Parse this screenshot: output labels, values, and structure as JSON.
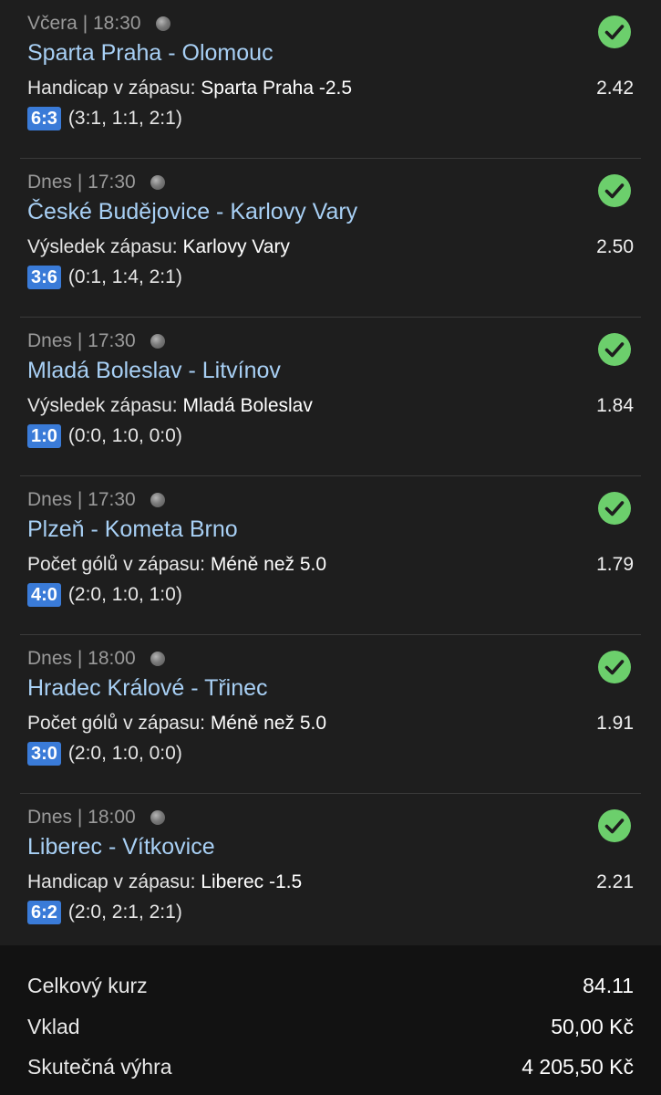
{
  "bets": [
    {
      "time": "Včera | 18:30",
      "match": "Sparta Praha - Olomouc",
      "market_label": "Handicap v zápasu:",
      "pick": "Sparta Praha -2.5",
      "odds": "2.42",
      "score": "6:3",
      "periods": "(3:1, 1:1, 2:1)",
      "status": "won",
      "status_icon": "check-circle-icon"
    },
    {
      "time": "Dnes | 17:30",
      "match": "České Budějovice - Karlovy Vary",
      "market_label": "Výsledek zápasu:",
      "pick": "Karlovy Vary",
      "odds": "2.50",
      "score": "3:6",
      "periods": "(0:1, 1:4, 2:1)",
      "status": "won",
      "status_icon": "check-circle-icon"
    },
    {
      "time": "Dnes | 17:30",
      "match": "Mladá Boleslav - Litvínov",
      "market_label": "Výsledek zápasu:",
      "pick": "Mladá Boleslav",
      "odds": "1.84",
      "score": "1:0",
      "periods": "(0:0, 1:0, 0:0)",
      "status": "won",
      "status_icon": "check-circle-icon"
    },
    {
      "time": "Dnes | 17:30",
      "match": "Plzeň - Kometa Brno",
      "market_label": "Počet gólů v zápasu:",
      "pick": "Méně než 5.0",
      "odds": "1.79",
      "score": "4:0",
      "periods": "(2:0, 1:0, 1:0)",
      "status": "won",
      "status_icon": "check-circle-icon"
    },
    {
      "time": "Dnes | 18:00",
      "match": "Hradec Králové - Třinec",
      "market_label": "Počet gólů v zápasu:",
      "pick": "Méně než 5.0",
      "odds": "1.91",
      "score": "3:0",
      "periods": "(2:0, 1:0, 0:0)",
      "status": "won",
      "status_icon": "check-circle-icon"
    },
    {
      "time": "Dnes | 18:00",
      "match": "Liberec - Vítkovice",
      "market_label": "Handicap v zápasu:",
      "pick": "Liberec -1.5",
      "odds": "2.21",
      "score": "6:2",
      "periods": "(2:0, 2:1, 2:1)",
      "status": "won",
      "status_icon": "check-circle-icon"
    }
  ],
  "summary": {
    "total_odds_label": "Celkový kurz",
    "total_odds_value": "84.11",
    "stake_label": "Vklad",
    "stake_value": "50,00 Kč",
    "win_label": "Skutečná výhra",
    "win_value": "4 205,50 Kč"
  },
  "colors": {
    "background": "#1e1e1e",
    "summary_background": "#121212",
    "match_link": "#a8d0f5",
    "score_badge": "#3a7bd8",
    "won_check": "#6ccf6c"
  }
}
